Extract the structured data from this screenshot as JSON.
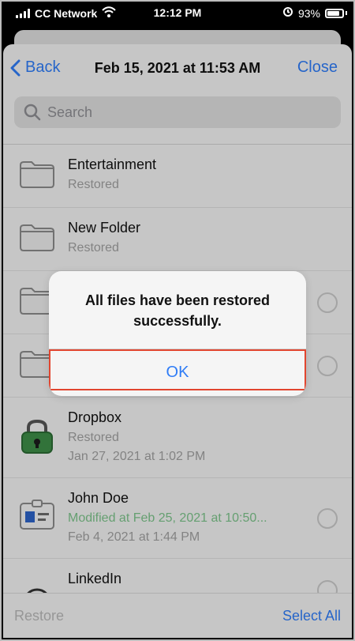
{
  "status_bar": {
    "carrier": "CC Network",
    "time": "12:12 PM",
    "battery": "93%"
  },
  "navbar": {
    "back_label": "Back",
    "title": "Feb 15, 2021 at 11:53 AM",
    "close_label": "Close"
  },
  "search": {
    "placeholder": "Search"
  },
  "items": [
    {
      "title": "Entertainment",
      "sub1": "Restored"
    },
    {
      "title": "New Folder",
      "sub1": "Restored"
    },
    {
      "title": "",
      "sub1": ""
    },
    {
      "title": "",
      "sub1": ""
    },
    {
      "title": "Dropbox",
      "sub1": "Restored",
      "sub2": "Jan 27, 2021 at 1:02 PM"
    },
    {
      "title": "John Doe",
      "sub1": "Modified at Feb 25, 2021 at 10:50...",
      "sub2": "Feb 4, 2021 at 1:44 PM"
    },
    {
      "title": "LinkedIn"
    }
  ],
  "bottom_bar": {
    "restore_label": "Restore",
    "select_all_label": "Select All"
  },
  "alert": {
    "message": "All files have been restored successfully.",
    "ok_label": "OK"
  },
  "colors": {
    "accent": "#2f7cf6",
    "highlight": "#e2452f",
    "green_text": "#7cc38a",
    "lock_green": "#3d8d47"
  }
}
